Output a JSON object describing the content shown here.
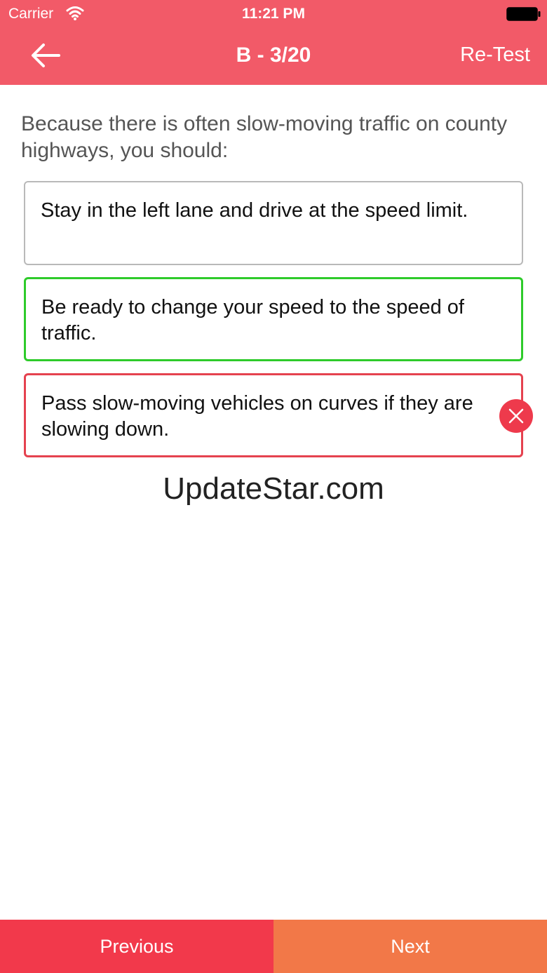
{
  "status_bar": {
    "carrier": "Carrier",
    "time": "11:21 PM"
  },
  "nav": {
    "back_icon": "arrow-left-icon",
    "title": "B - 3/20",
    "retest_label": "Re-Test"
  },
  "question": {
    "text": "Because there is often slow-moving traffic on county highways, you should:",
    "options": [
      {
        "text": "Stay in the left lane and drive at the speed limit.",
        "state": "neutral"
      },
      {
        "text": "Be ready to change your speed to the speed of traffic.",
        "state": "correct"
      },
      {
        "text": "Pass slow-moving vehicles on curves if they are slowing down.",
        "state": "incorrect"
      }
    ],
    "wrong_marker_icon": "close-circle-icon"
  },
  "watermark": "UpdateStar.com",
  "footer": {
    "previous_label": "Previous",
    "next_label": "Next"
  },
  "colors": {
    "header": "#f25a68",
    "correct": "#2ecb2a",
    "incorrect": "#e5424f",
    "previous_button": "#f2394b",
    "next_button": "#f27848"
  }
}
